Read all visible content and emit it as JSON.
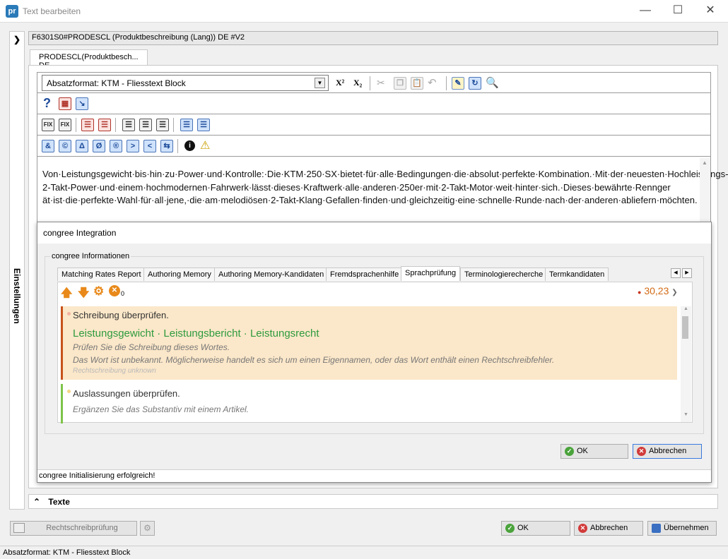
{
  "window": {
    "title": "Text bearbeiten",
    "app_icon": "pr"
  },
  "side": {
    "label": "Einstellungen"
  },
  "path": "F6301S0#PRODESCL (Produktbeschreibung (Lang)) DE #V2",
  "tab": "PRODESCL(Produktbesch... DE",
  "toolbar": {
    "paragraph_format": "Absatzformat: KTM - Fliesstext Block",
    "superscript": "X²",
    "subscript": "X₂",
    "row3": [
      "FIX",
      "FIX"
    ],
    "row4": [
      "&",
      "©",
      "Δ",
      "Ø",
      "®",
      ">",
      "<",
      "⇆"
    ]
  },
  "editor": {
    "text": "Von·Leistungsgewicht·bis·hin·zu·Power·und·Kontrolle:·Die·KTM·250·SX·bietet·für·alle·Bedingungen·die·absolut·perfekte·Kombination.·Mit·der·neuesten·Hochleistungs-2-Takt-Power·und·einem·hochmodernen·Fahrwerk·lässt·dieses·Kraftwerk·alle·anderen·250er·mit·2-Takt-Motor·weit·hinter·sich.·Dieses·bewährte·Rennger ät·ist·die·perfekte·Wahl·für·all·jene,·die·am·melodiösen·2-Takt-Klang·Gefallen·finden·und·gleichzeitig·eine·schnelle·Runde·nach·der·anderen·abliefern·möchten."
  },
  "congree": {
    "title": "congree Integration",
    "group": "congree Informationen",
    "tabs": [
      "Matching Rates Report",
      "Authoring Memory",
      "Authoring Memory-Kandidaten",
      "Fremdsprachenhilfe",
      "Sprachprüfung",
      "Terminologierecherche",
      "Termkandidaten"
    ],
    "active_tab": "Sprachprüfung",
    "error_count": "0",
    "score": "30,23",
    "issues": [
      {
        "title": "Schreibung überprüfen.",
        "suggestions": "Leistungsgewicht · Leistungsbericht · Leistungsrecht",
        "hint": "Prüfen Sie die Schreibung dieses Wortes.",
        "detail": "Das Wort ist unbekannt. Möglicherweise handelt es sich um einen Eigennamen, oder das Wort enthält einen Rechtschreibfehler.",
        "rule": "Rechtschreibung unknown",
        "color": "#c7521a"
      },
      {
        "title": "Auslassungen überprüfen.",
        "hint": "Ergänzen Sie das Substantiv mit einem Artikel.",
        "color": "#7ec44a"
      }
    ],
    "ok": "OK",
    "cancel": "Abbrechen",
    "status": "congree Initialisierung erfolgreich!"
  },
  "texte": "Texte",
  "bottom": {
    "spellcheck": "Rechtschreibprüfung",
    "ok": "OK",
    "cancel": "Abbrechen",
    "apply": "Übernehmen"
  },
  "statusbar": "Absatzformat: KTM - Fliesstext Block"
}
